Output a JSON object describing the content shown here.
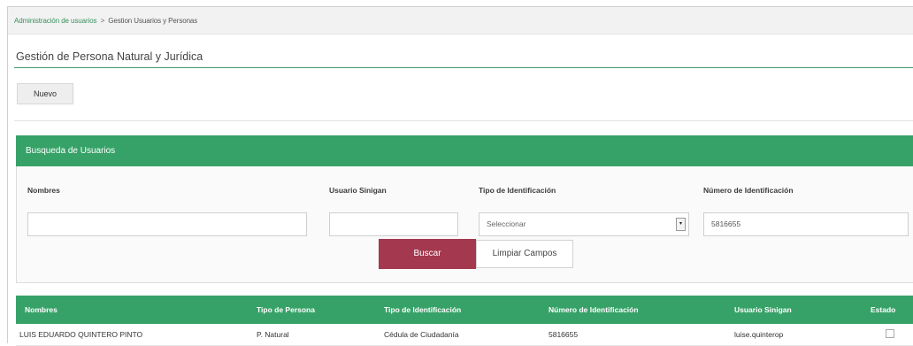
{
  "breadcrumb": {
    "parent": "Administración de usuarios",
    "separator": ">",
    "current": "Gestion Usuarios y Personas"
  },
  "page": {
    "title": "Gestión de Persona Natural y Jurídica",
    "new_button": "Nuevo"
  },
  "search_panel": {
    "title": "Busqueda de Usuarios",
    "fields": {
      "nombres": {
        "label": "Nombres",
        "value": ""
      },
      "usuario": {
        "label": "Usuario Sinigan",
        "value": ""
      },
      "tipo": {
        "label": "Tipo de Identificación",
        "value": "Seleccionar"
      },
      "numero": {
        "label": "Número de Identificación",
        "value": "5816655"
      }
    },
    "search_button": "Buscar",
    "clear_button": "Limpiar Campos"
  },
  "results": {
    "columns": [
      "Nombres",
      "Tipo de Persona",
      "Tipo de Identificación",
      "Número de Identificación",
      "Usuario Sinigan",
      "Estado"
    ],
    "rows": [
      {
        "nombres": "LUIS EDUARDO QUINTERO PINTO",
        "tipo_persona": "P. Natural",
        "tipo_identificacion": "Cédula de Ciudadanía",
        "numero": "5816655",
        "usuario": "luise.quinterop",
        "estado_checked": false
      }
    ]
  },
  "colors": {
    "accent_green": "#37a268",
    "search_button": "#a3384e"
  }
}
